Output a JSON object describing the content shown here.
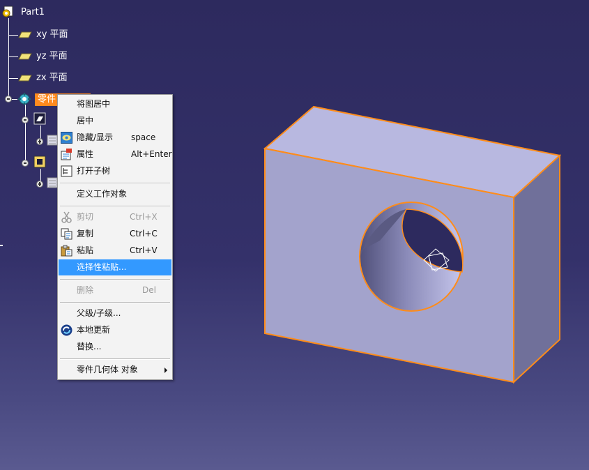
{
  "tree": {
    "root_label": "Part1",
    "planes": [
      {
        "label": "xy 平面"
      },
      {
        "label": "yz 平面"
      },
      {
        "label": "zx 平面"
      }
    ],
    "selected_label": "零件"
  },
  "context_menu": {
    "items": [
      {
        "label": "将图居中",
        "shortcut": "",
        "enabled": true
      },
      {
        "label": "居中",
        "shortcut": "",
        "enabled": true
      },
      {
        "label": "隐藏/显示",
        "shortcut": "space",
        "enabled": true
      },
      {
        "label": "属性",
        "shortcut": "Alt+Enter",
        "enabled": true
      },
      {
        "label": "打开子树",
        "shortcut": "",
        "enabled": true
      },
      {
        "label": "定义工作对象",
        "shortcut": "",
        "enabled": true
      },
      {
        "label": "剪切",
        "shortcut": "Ctrl+X",
        "enabled": false
      },
      {
        "label": "复制",
        "shortcut": "Ctrl+C",
        "enabled": true
      },
      {
        "label": "粘贴",
        "shortcut": "Ctrl+V",
        "enabled": true
      },
      {
        "label": "选择性粘贴...",
        "shortcut": "",
        "enabled": true,
        "highlighted": true
      },
      {
        "label": "删除",
        "shortcut": "Del",
        "enabled": false
      },
      {
        "label": "父级/子级...",
        "shortcut": "",
        "enabled": true
      },
      {
        "label": "本地更新",
        "shortcut": "",
        "enabled": true
      },
      {
        "label": "替换...",
        "shortcut": "",
        "enabled": true
      },
      {
        "label": "零件几何体 对象",
        "shortcut": "",
        "enabled": true,
        "submenu": true
      }
    ]
  },
  "colors": {
    "background": "#2d2a5e",
    "selection": "#ff8a1e",
    "menu_highlight": "#3399ff",
    "model_face": "#a9a9d2",
    "model_edge": "#ff8c1a"
  }
}
